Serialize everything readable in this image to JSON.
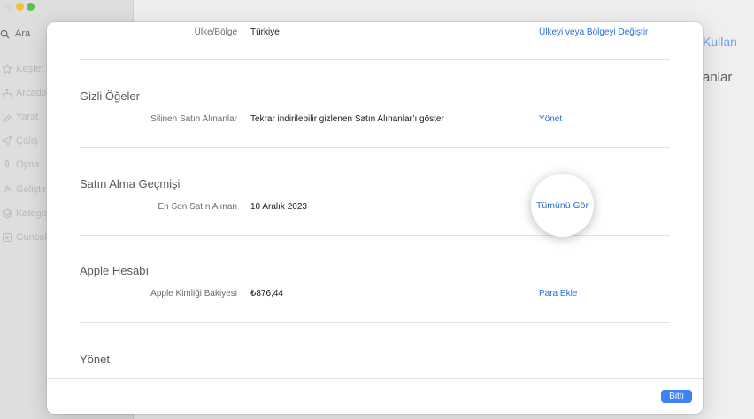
{
  "background": {
    "search_placeholder": "Ara",
    "nav_items": [
      "Keşfet",
      "Arcade",
      "Yarat",
      "Çalış",
      "Oyna",
      "Geliştir",
      "Kategoriler",
      "Güncellemeler"
    ],
    "top_right_link": "Kullan",
    "top_right_heading": "anlar"
  },
  "sheet": {
    "country_row": {
      "label": "Ülke/Bölge",
      "value": "Türkiye",
      "action": "Ülkeyi veya Bölgeyi Değiştir"
    },
    "hidden_items": {
      "title": "Gizli Öğeler",
      "row": {
        "label": "Silinen Satın Alınanlar",
        "value": "Tekrar indirilebilir gizlenen Satın Alınanlar’ı göster",
        "action": "Yönet"
      }
    },
    "purchase_history": {
      "title": "Satın Alma Geçmişi",
      "row": {
        "label": "En Son Satın Alınan",
        "value": "10 Aralık 2023",
        "action": "Tümünü Gör"
      }
    },
    "apple_account": {
      "title": "Apple Hesabı",
      "row": {
        "label": "Apple Kimliği Bakiyesi",
        "value": "₺876,44",
        "action": "Para Ekle"
      }
    },
    "manage": {
      "title": "Yönet"
    },
    "done_label": "Bitti"
  },
  "colors": {
    "accent": "#2a6fd6",
    "button": "#3b82f6"
  }
}
